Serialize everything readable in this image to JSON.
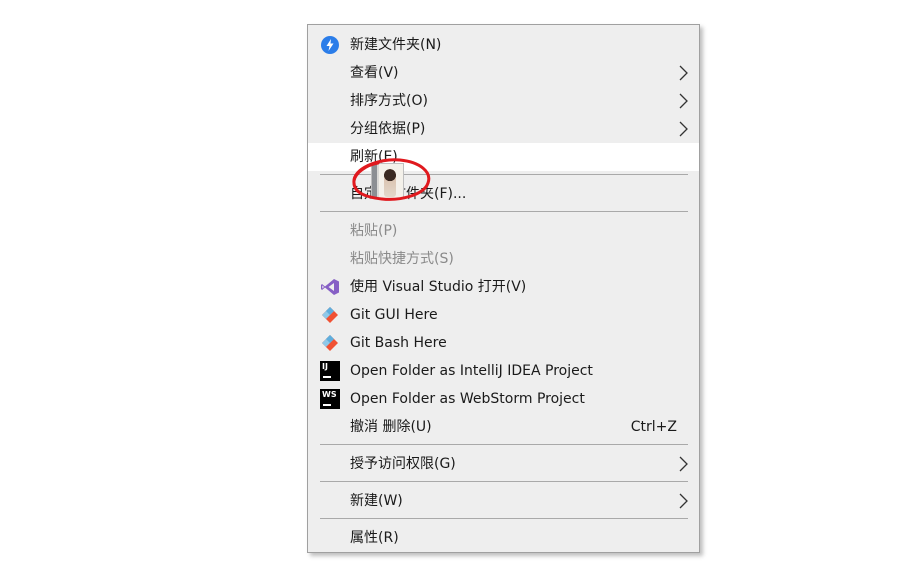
{
  "menu": {
    "items": [
      {
        "label": "新建文件夹(N)",
        "icon": "new-folder-blue-icon"
      },
      {
        "label": "查看(V)",
        "submenu": true
      },
      {
        "label": "排序方式(O)",
        "submenu": true
      },
      {
        "label": "分组依据(P)",
        "submenu": true
      },
      {
        "label": "刷新(E)",
        "highlighted": true
      },
      {
        "label": "自定义文件夹(F)..."
      },
      {
        "label": "粘贴(P)",
        "disabled": true
      },
      {
        "label": "粘贴快捷方式(S)",
        "disabled": true
      },
      {
        "label": "使用 Visual Studio 打开(V)",
        "icon": "visual-studio-icon"
      },
      {
        "label": "Git GUI Here",
        "icon": "git-gui-icon"
      },
      {
        "label": "Git Bash Here",
        "icon": "git-bash-icon"
      },
      {
        "label": "Open Folder as IntelliJ IDEA Project",
        "icon": "intellij-icon",
        "icon_text": "IJ"
      },
      {
        "label": "Open Folder as WebStorm Project",
        "icon": "webstorm-icon",
        "icon_text": "WS"
      },
      {
        "label": "撤消 删除(U)",
        "shortcut": "Ctrl+Z"
      },
      {
        "label": "授予访问权限(G)",
        "submenu": true
      },
      {
        "label": "新建(W)",
        "submenu": true
      },
      {
        "label": "属性(R)"
      }
    ]
  },
  "overlay": {
    "annotation": "red-circle-annotation",
    "thumbnail": "portrait-thumbnail"
  },
  "colors": {
    "menu_bg": "#eeeeee",
    "highlight": "#ffffff",
    "disabled_text": "#8a8a8a",
    "annotation_red": "#e0191e",
    "accent_blue": "#2b7de9"
  }
}
